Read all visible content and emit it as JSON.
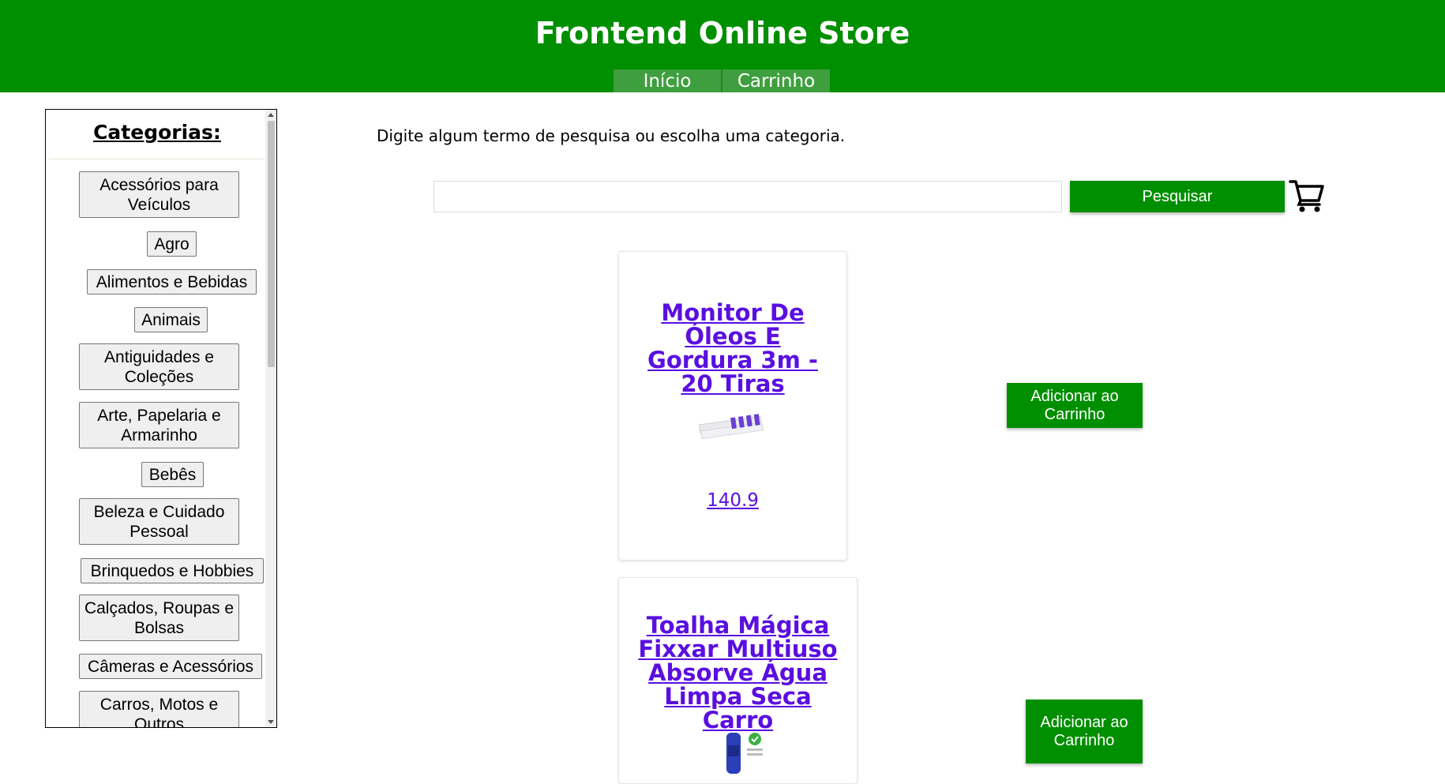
{
  "header": {
    "title": "Frontend Online Store",
    "nav": [
      "Início",
      "Carrinho"
    ]
  },
  "sidebar": {
    "title": "Categorias:",
    "categories": [
      "Acessórios para Veículos",
      "Agro",
      "Alimentos e Bebidas",
      "Animais",
      "Antiguidades e Coleções",
      "Arte, Papelaria e Armarinho",
      "Bebês",
      "Beleza e Cuidado Pessoal",
      "Brinquedos e Hobbies",
      "Calçados, Roupas e Bolsas",
      "Câmeras e Acessórios",
      "Carros, Motos e Outros"
    ]
  },
  "main": {
    "hint": "Digite algum termo de pesquisa ou escolha uma categoria.",
    "search": {
      "value": "",
      "button": "Pesquisar"
    },
    "products": [
      {
        "title": "Monitor De Óleos E Gordura 3m - 20 Tiras",
        "price": "140.9",
        "add_label": "Adicionar ao Carrinho"
      },
      {
        "title": "Toalha Mágica Fixxar Multiuso Absorve Água Limpa Seca Carro",
        "price": "",
        "add_label": "Adicionar ao Carrinho"
      }
    ]
  },
  "colors": {
    "header": "#008f00",
    "link": "#5a0fe0",
    "button": "#008f00"
  },
  "icons": {
    "cart": "shopping-cart-icon"
  }
}
